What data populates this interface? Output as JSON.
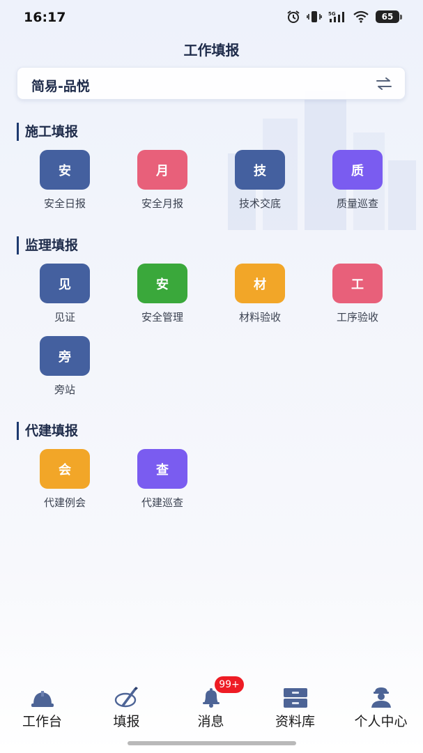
{
  "status": {
    "time": "16:17",
    "battery": "65",
    "network": "5G"
  },
  "header": {
    "title": "工作填报"
  },
  "project": {
    "name": "简易-品悦"
  },
  "sections": [
    {
      "title": "施工填报",
      "items": [
        {
          "char": "安",
          "label": "安全日报",
          "color": "#44609f"
        },
        {
          "char": "月",
          "label": "安全月报",
          "color": "#e8607a"
        },
        {
          "char": "技",
          "label": "技术交底",
          "color": "#44609f"
        },
        {
          "char": "质",
          "label": "质量巡查",
          "color": "#7a5cf0"
        }
      ]
    },
    {
      "title": "监理填报",
      "items": [
        {
          "char": "见",
          "label": "见证",
          "color": "#44609f"
        },
        {
          "char": "安",
          "label": "安全管理",
          "color": "#3aa83b"
        },
        {
          "char": "材",
          "label": "材料验收",
          "color": "#f2a628"
        },
        {
          "char": "工",
          "label": "工序验收",
          "color": "#e8607a"
        },
        {
          "char": "旁",
          "label": "旁站",
          "color": "#44609f"
        }
      ]
    },
    {
      "title": "代建填报",
      "items": [
        {
          "char": "会",
          "label": "代建例会",
          "color": "#f2a628"
        },
        {
          "char": "查",
          "label": "代建巡查",
          "color": "#7a5cf0"
        }
      ]
    }
  ],
  "nav": {
    "items": [
      {
        "label": "工作台",
        "icon": "helmet-icon"
      },
      {
        "label": "填报",
        "icon": "pen-icon"
      },
      {
        "label": "消息",
        "icon": "bell-icon",
        "badge": "99+"
      },
      {
        "label": "资料库",
        "icon": "cabinet-icon"
      },
      {
        "label": "个人中心",
        "icon": "worker-icon"
      }
    ]
  }
}
